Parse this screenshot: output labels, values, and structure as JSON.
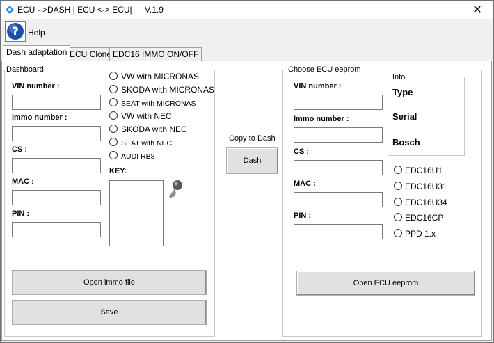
{
  "window": {
    "title": "ECU - >DASH | ECU <-> ECU|",
    "version": "V.1.9",
    "close_label": "✕"
  },
  "toolbar": {
    "help_label": "Help",
    "help_glyph": "?"
  },
  "tabs": [
    {
      "label": "Dash adaptation",
      "active": true
    },
    {
      "label": "ECU Clone",
      "active": false
    },
    {
      "label": "EDC16 IMMO ON/OFF",
      "active": false
    }
  ],
  "dashboard": {
    "title": "Dashboard",
    "fields": [
      {
        "label": "VIN number :",
        "value": ""
      },
      {
        "label": "Immo number :",
        "value": ""
      },
      {
        "label": "CS :",
        "value": ""
      },
      {
        "label": "MAC :",
        "value": ""
      },
      {
        "label": "PIN :",
        "value": ""
      }
    ],
    "radios": [
      {
        "label": "VW with MICRONAS",
        "selected": false
      },
      {
        "label": "SKODA with MICRONAS",
        "selected": false
      },
      {
        "label": "SEAT with MICRONAS",
        "selected": false
      },
      {
        "label": "VW with NEC",
        "selected": false
      },
      {
        "label": "SKODA with NEC",
        "selected": false
      },
      {
        "label": "SEAT with NEC",
        "selected": false
      },
      {
        "label": "AUDI RB8",
        "selected": false
      }
    ],
    "key_label": "KEY:",
    "open_button": "Open immo file",
    "save_button": "Save"
  },
  "middle": {
    "copy_label": "Copy to Dash",
    "dash_button": "Dash"
  },
  "ecu": {
    "title": "Choose ECU eeprom",
    "fields": [
      {
        "label": "VIN number :",
        "value": ""
      },
      {
        "label": "Immo number :",
        "value": ""
      },
      {
        "label": "CS :",
        "value": ""
      },
      {
        "label": "MAC :",
        "value": ""
      },
      {
        "label": "PIN :",
        "value": ""
      }
    ],
    "info": {
      "title": "Info",
      "type": "Type",
      "serial": "Serial",
      "bosch": "Bosch"
    },
    "radios": [
      {
        "label": "EDC16U1",
        "selected": false
      },
      {
        "label": "EDC16U31",
        "selected": false
      },
      {
        "label": "EDC16U34",
        "selected": false
      },
      {
        "label": "EDC16CP",
        "selected": false
      },
      {
        "label": "PPD 1.x",
        "selected": false
      }
    ],
    "open_button": "Open ECU eeprom"
  }
}
